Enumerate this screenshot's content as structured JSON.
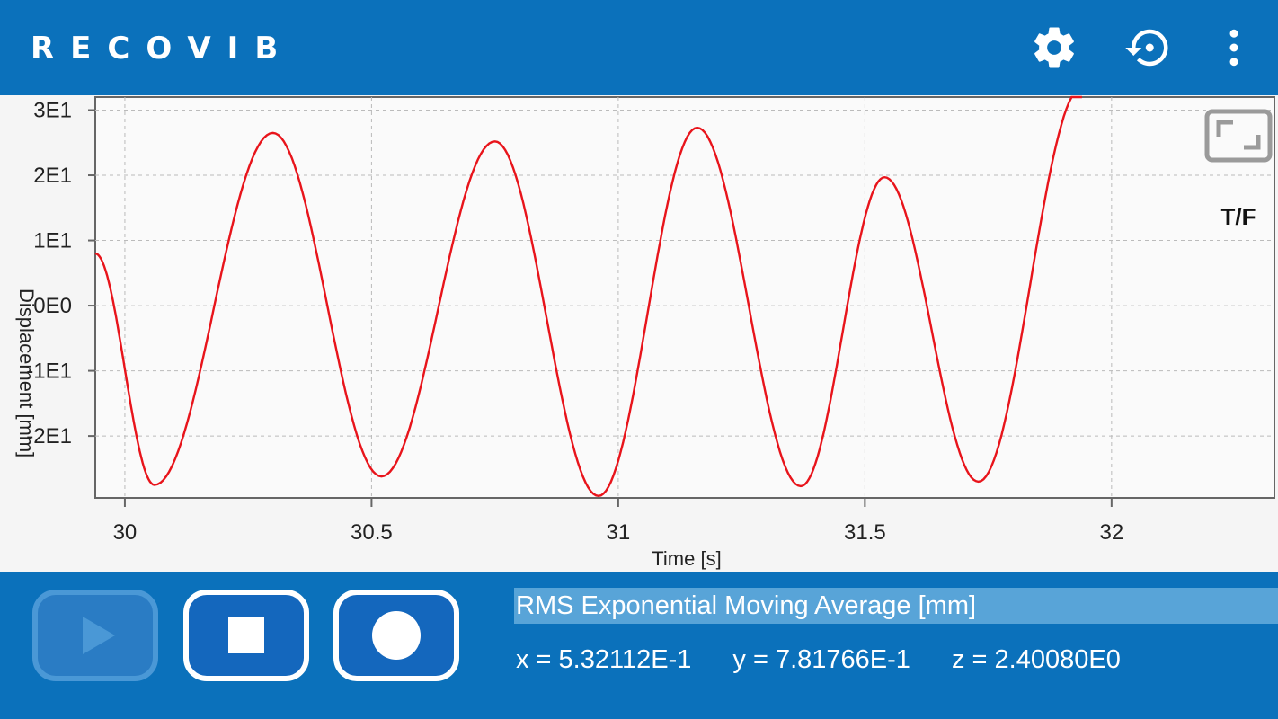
{
  "app": {
    "logo_text": "RECOVIB"
  },
  "header": {
    "icons": [
      "gear-icon",
      "reset-icon",
      "more-vert-icon"
    ]
  },
  "chart_data": {
    "type": "line",
    "xlabel": "Time [s]",
    "ylabel": "Displacement [mm]",
    "xlim": [
      29.94,
      32.33
    ],
    "ylim": [
      -2.95,
      3.2
    ],
    "x_ticks": [
      30,
      30.5,
      31,
      31.5,
      32
    ],
    "x_tick_labels": [
      "30",
      "30.5",
      "31",
      "31.5",
      "32"
    ],
    "y_ticks": [
      3,
      2,
      1,
      0,
      -1,
      -2
    ],
    "y_tick_labels": [
      "3E1",
      "2E1",
      "1E1",
      "0E0",
      "-1E1",
      "-2E1"
    ],
    "grid": true,
    "series": [
      {
        "color": "#e8141b",
        "extrema": [
          [
            29.94,
            0.8
          ],
          [
            30.06,
            -2.75
          ],
          [
            30.3,
            2.65
          ],
          [
            30.52,
            -2.62
          ],
          [
            30.75,
            2.52
          ],
          [
            30.96,
            -2.92
          ],
          [
            31.16,
            2.73
          ],
          [
            31.37,
            -2.77
          ],
          [
            31.54,
            1.97
          ],
          [
            31.73,
            -2.7
          ],
          [
            31.94,
            3.35
          ]
        ]
      }
    ],
    "mode_label": "T/F"
  },
  "controls": {
    "play": {
      "icon": "play-icon",
      "enabled": false
    },
    "stop": {
      "icon": "stop-icon",
      "enabled": true
    },
    "record": {
      "icon": "record-icon",
      "enabled": true
    }
  },
  "info": {
    "title": "RMS Exponential Moving Average [mm]",
    "x": "x = 5.32112E-1",
    "y": "y = 7.81766E-1",
    "z": "z = 2.40080E0"
  }
}
